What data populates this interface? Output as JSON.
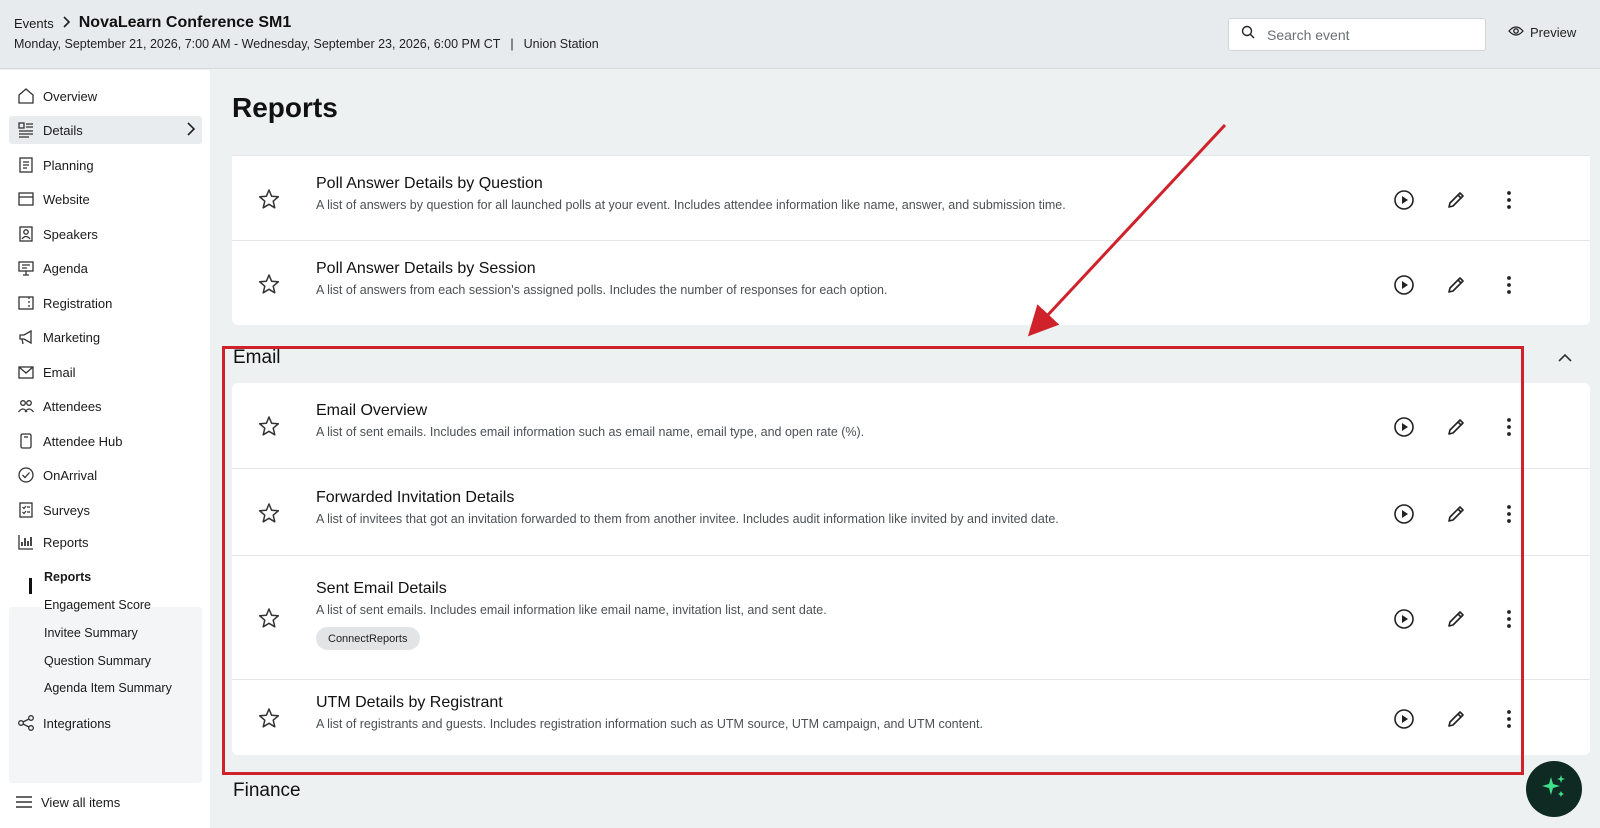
{
  "header": {
    "breadcrumb_root": "Events",
    "breadcrumb_sep": ">",
    "event_title": "NovaLearn Conference SM1",
    "event_dates": "Monday, September 21, 2026, 7:00 AM - Wednesday, September 23, 2026, 6:00 PM CT",
    "meta_sep": "|",
    "venue": "Union Station",
    "search_placeholder": "Search event",
    "preview_label": "Preview"
  },
  "sidebar": {
    "items": [
      {
        "label": "Overview",
        "icon": "home-icon"
      },
      {
        "label": "Details",
        "icon": "details-icon"
      },
      {
        "label": "Planning",
        "icon": "planning-icon"
      },
      {
        "label": "Website",
        "icon": "website-icon"
      },
      {
        "label": "Speakers",
        "icon": "speakers-icon"
      },
      {
        "label": "Agenda",
        "icon": "agenda-icon"
      },
      {
        "label": "Registration",
        "icon": "registration-icon"
      },
      {
        "label": "Marketing",
        "icon": "marketing-icon"
      },
      {
        "label": "Email",
        "icon": "email-icon"
      },
      {
        "label": "Attendees",
        "icon": "attendees-icon"
      },
      {
        "label": "Attendee Hub",
        "icon": "attendee-hub-icon"
      },
      {
        "label": "OnArrival",
        "icon": "onarrival-icon"
      },
      {
        "label": "Surveys",
        "icon": "surveys-icon"
      },
      {
        "label": "Reports",
        "icon": "reports-icon"
      }
    ],
    "report_sub_items": [
      "Reports",
      "Engagement Score",
      "Invitee Summary",
      "Question Summary",
      "Agenda Item Summary"
    ],
    "integrations_label": "Integrations",
    "view_all_label": "View all items"
  },
  "main": {
    "page_title": "Reports",
    "poll_rows": [
      {
        "title": "Poll Answer Details by Question",
        "desc": "A list of answers by question for all launched polls at your event. Includes attendee information like name, answer, and submission time."
      },
      {
        "title": "Poll Answer Details by Session",
        "desc": "A list of answers from each session's assigned polls. Includes the number of responses for each option."
      }
    ],
    "email_section_title": "Email",
    "email_rows": [
      {
        "title": "Email Overview",
        "desc": "A list of sent emails. Includes email information such as email name, email type, and open rate (%)."
      },
      {
        "title": "Forwarded Invitation Details",
        "desc": "A list of invitees that got an invitation forwarded to them from another invitee. Includes audit information like invited by and invited date."
      },
      {
        "title": "Sent Email Details",
        "desc": "A list of sent emails. Includes email information like email name, invitation list, and sent date.",
        "tag": "ConnectReports"
      },
      {
        "title": "UTM Details by Registrant",
        "desc": "A list of registrants and guests. Includes registration information such as UTM source, UTM campaign, and UTM content."
      }
    ],
    "finance_section_title": "Finance"
  },
  "colors": {
    "annotation": "#d0222b",
    "fab": "#0e2a22",
    "fab_icon": "#3fe08a"
  }
}
